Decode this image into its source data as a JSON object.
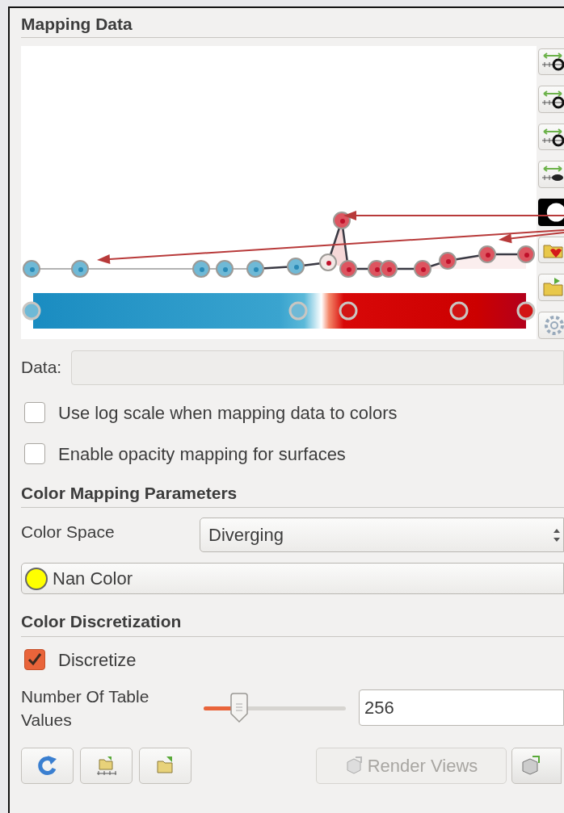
{
  "mapping_data": {
    "title": "Mapping Data",
    "data_field": {
      "label": "Data:"
    }
  },
  "options": [
    {
      "label": "Use log scale when mapping data to colors",
      "checked": false
    },
    {
      "label": "Enable opacity mapping for surfaces",
      "checked": false
    }
  ],
  "color_mapping": {
    "title": "Color Mapping Parameters",
    "color_space": {
      "label": "Color Space",
      "value": "Diverging"
    },
    "nan_color": {
      "label": "Nan Color",
      "color": "#ffff00"
    }
  },
  "discretization": {
    "title": "Color Discretization",
    "discretize": {
      "label": "Discretize",
      "checked": true
    },
    "table_values": {
      "label": "Number Of Table Values",
      "level": 0.25,
      "value": "256"
    }
  },
  "render_views": {
    "label": "Render Views",
    "disabled": true
  }
}
